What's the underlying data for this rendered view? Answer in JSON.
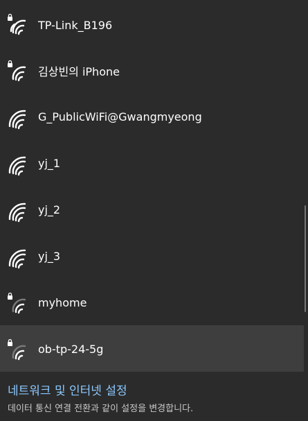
{
  "networks": [
    {
      "ssid": "TP-Link_B196",
      "secured": true,
      "icon": "wifi-secured-icon"
    },
    {
      "ssid": "김상빈의 iPhone",
      "secured": true,
      "icon": "wifi-secured-icon"
    },
    {
      "ssid": "G_PublicWiFi@Gwangmyeong",
      "secured": false,
      "icon": "wifi-icon"
    },
    {
      "ssid": "yj_1",
      "secured": false,
      "icon": "wifi-icon"
    },
    {
      "ssid": "yj_2",
      "secured": false,
      "icon": "wifi-icon"
    },
    {
      "ssid": "yj_3",
      "secured": false,
      "icon": "wifi-icon"
    },
    {
      "ssid": "myhome",
      "secured": true,
      "icon": "wifi-secured-icon"
    },
    {
      "ssid": "ob-tp-24-5g",
      "secured": true,
      "icon": "wifi-secured-icon",
      "selected": true
    }
  ],
  "footer": {
    "settings_link": "네트워크 및 인터넷 설정",
    "settings_desc": "데이터 통신 연결 전환과 같이 설정을 변경합니다."
  },
  "colors": {
    "background": "#2b2b2b",
    "selected_row": "#3e3e3e",
    "link": "#8cc8ff",
    "text": "#ffffff",
    "secondary_text": "#c8c8c8"
  }
}
